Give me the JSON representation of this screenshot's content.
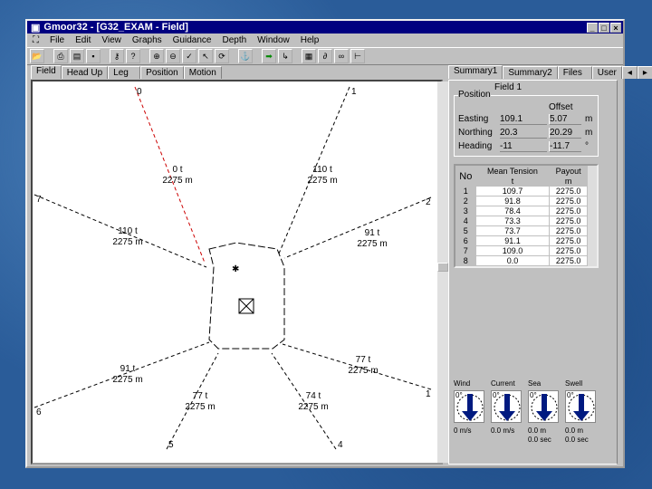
{
  "window": {
    "title": "Gmoor32 - [G32_EXAM - Field]"
  },
  "menu": [
    "File",
    "Edit",
    "View",
    "Graphs",
    "Guidance",
    "Depth",
    "Window",
    "Help"
  ],
  "field_tabs": [
    "Field",
    "Head Up",
    "Leg",
    "Position",
    "Motion"
  ],
  "right_tabs": [
    "Summary1",
    "Summary2",
    "Files",
    "User"
  ],
  "summary": {
    "header": "Field 1",
    "position_group": "Position",
    "offset_label": "Offset",
    "rows": [
      {
        "label": "Easting",
        "value": "109.1",
        "offset": "5.07",
        "unit": "m"
      },
      {
        "label": "Northing",
        "value": "20.3",
        "offset": "20.29",
        "unit": "m"
      },
      {
        "label": "Heading",
        "value": "-11",
        "offset": "-11.7",
        "unit": "°"
      }
    ]
  },
  "lines_table": {
    "headers": [
      "No",
      "Mean Tension",
      "Payout"
    ],
    "units": [
      "t",
      "m"
    ],
    "rows": [
      [
        "1",
        "109.7",
        "2275.0"
      ],
      [
        "2",
        "91.8",
        "2275.0"
      ],
      [
        "3",
        "78.4",
        "2275.0"
      ],
      [
        "4",
        "73.3",
        "2275.0"
      ],
      [
        "5",
        "73.7",
        "2275.0"
      ],
      [
        "6",
        "91.1",
        "2275.0"
      ],
      [
        "7",
        "109.0",
        "2275.0"
      ],
      [
        "8",
        "0.0",
        "2275.0"
      ]
    ]
  },
  "environment": [
    {
      "label": "Wind",
      "dir": "0°",
      "v1": "0 m/s",
      "v2": ""
    },
    {
      "label": "Current",
      "dir": "0°",
      "v1": "0.0 m/s",
      "v2": ""
    },
    {
      "label": "Sea",
      "dir": "0°",
      "v1": "0.0 m",
      "v2": "0.0 sec"
    },
    {
      "label": "Swell",
      "dir": "0°",
      "v1": "0.0 m",
      "v2": "0.0 sec"
    }
  ],
  "anchors": [
    {
      "no": "0",
      "tension": "0 t",
      "payout": "2275 m",
      "color": "#cc0000"
    },
    {
      "no": "1",
      "tension": "110 t",
      "payout": "2275 m",
      "color": "#000000"
    },
    {
      "no": "2",
      "tension": "91 t",
      "payout": "2275 m",
      "color": "#000000"
    },
    {
      "no": "7",
      "tension": "110 t",
      "payout": "2275 m",
      "color": "#000000"
    },
    {
      "no": "6",
      "tension": "91 t",
      "payout": "2275 m",
      "color": "#000000"
    },
    {
      "no": "1",
      "tension": "77 t",
      "payout": "2275 m",
      "color": "#000000"
    },
    {
      "no": "5",
      "tension": "77 t",
      "payout": "2275 m",
      "color": "#000000"
    },
    {
      "no": "4",
      "tension": "74 t",
      "payout": "2275 m",
      "color": "#000000"
    }
  ]
}
